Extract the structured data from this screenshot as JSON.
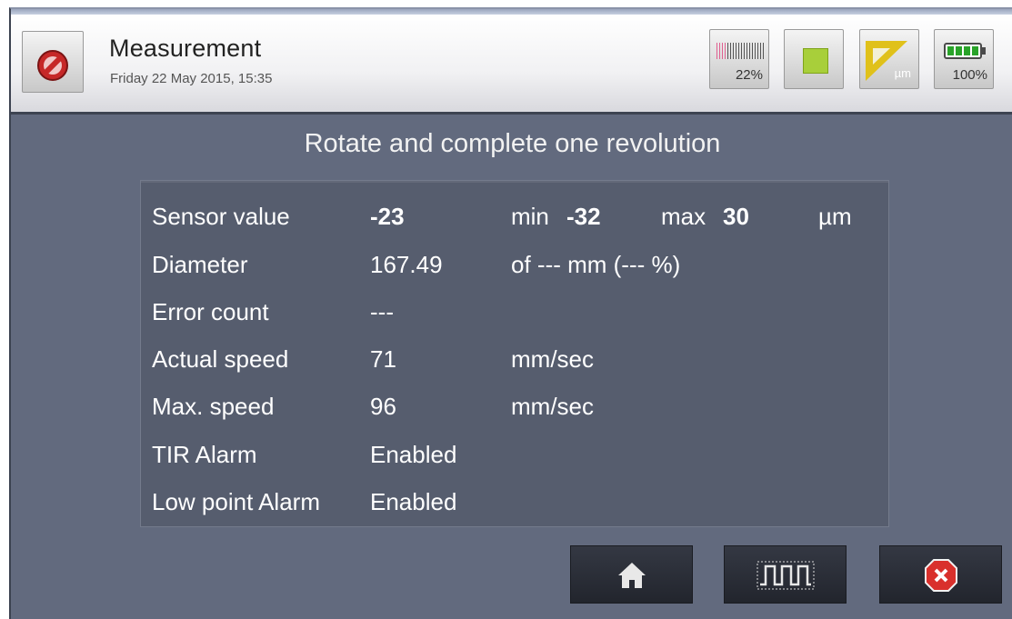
{
  "header": {
    "title": "Measurement",
    "datetime": "Friday 22 May 2015, 15:35",
    "back_icon": "no-entry-icon",
    "status": {
      "signal_label": "22%",
      "signal_icon": "signal-strength-icon",
      "stop_icon": "stop-square-icon",
      "unit_label": "µm",
      "unit_icon": "ruler-triangle-icon",
      "battery_label": "100%",
      "battery_icon": "battery-icon"
    }
  },
  "instruction": "Rotate and complete one revolution",
  "readings": {
    "sensor": {
      "label": "Sensor value",
      "value": "-23",
      "min_label": "min",
      "min_value": "-32",
      "max_label": "max",
      "max_value": "30",
      "unit": "µm"
    },
    "diameter": {
      "label": "Diameter",
      "value": "167.49",
      "extra": "of --- mm (--- %)"
    },
    "error_count": {
      "label": "Error count",
      "value": "---"
    },
    "actual_speed": {
      "label": "Actual speed",
      "value": "71",
      "unit": "mm/sec"
    },
    "max_speed": {
      "label": "Max. speed",
      "value": "96",
      "unit": "mm/sec"
    },
    "tir_alarm": {
      "label": "TIR Alarm",
      "value": "Enabled"
    },
    "low_point_alarm": {
      "label": "Low point Alarm",
      "value": "Enabled"
    }
  },
  "buttons": {
    "home_icon": "home-icon",
    "wave_icon": "square-wave-icon",
    "close_icon": "close-icon"
  },
  "colors": {
    "background": "#626a7e",
    "panel": "#565d6e",
    "accent_green": "#a8cf3a",
    "ruler_yellow": "#e0c11a",
    "close_red": "#d9302c"
  }
}
